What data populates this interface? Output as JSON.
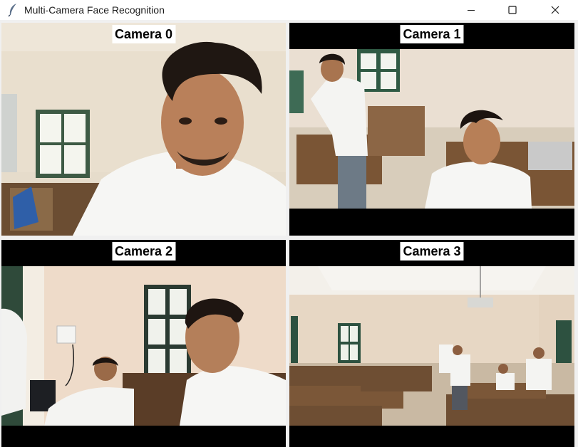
{
  "window": {
    "title": "Multi-Camera Face Recognition",
    "icon": "feather-icon",
    "controls": [
      "minimize-icon",
      "maximize-icon",
      "close-icon"
    ]
  },
  "cameras": [
    {
      "label": "Camera 0"
    },
    {
      "label": "Camera 1"
    },
    {
      "label": "Camera 2"
    },
    {
      "label": "Camera 3"
    }
  ]
}
